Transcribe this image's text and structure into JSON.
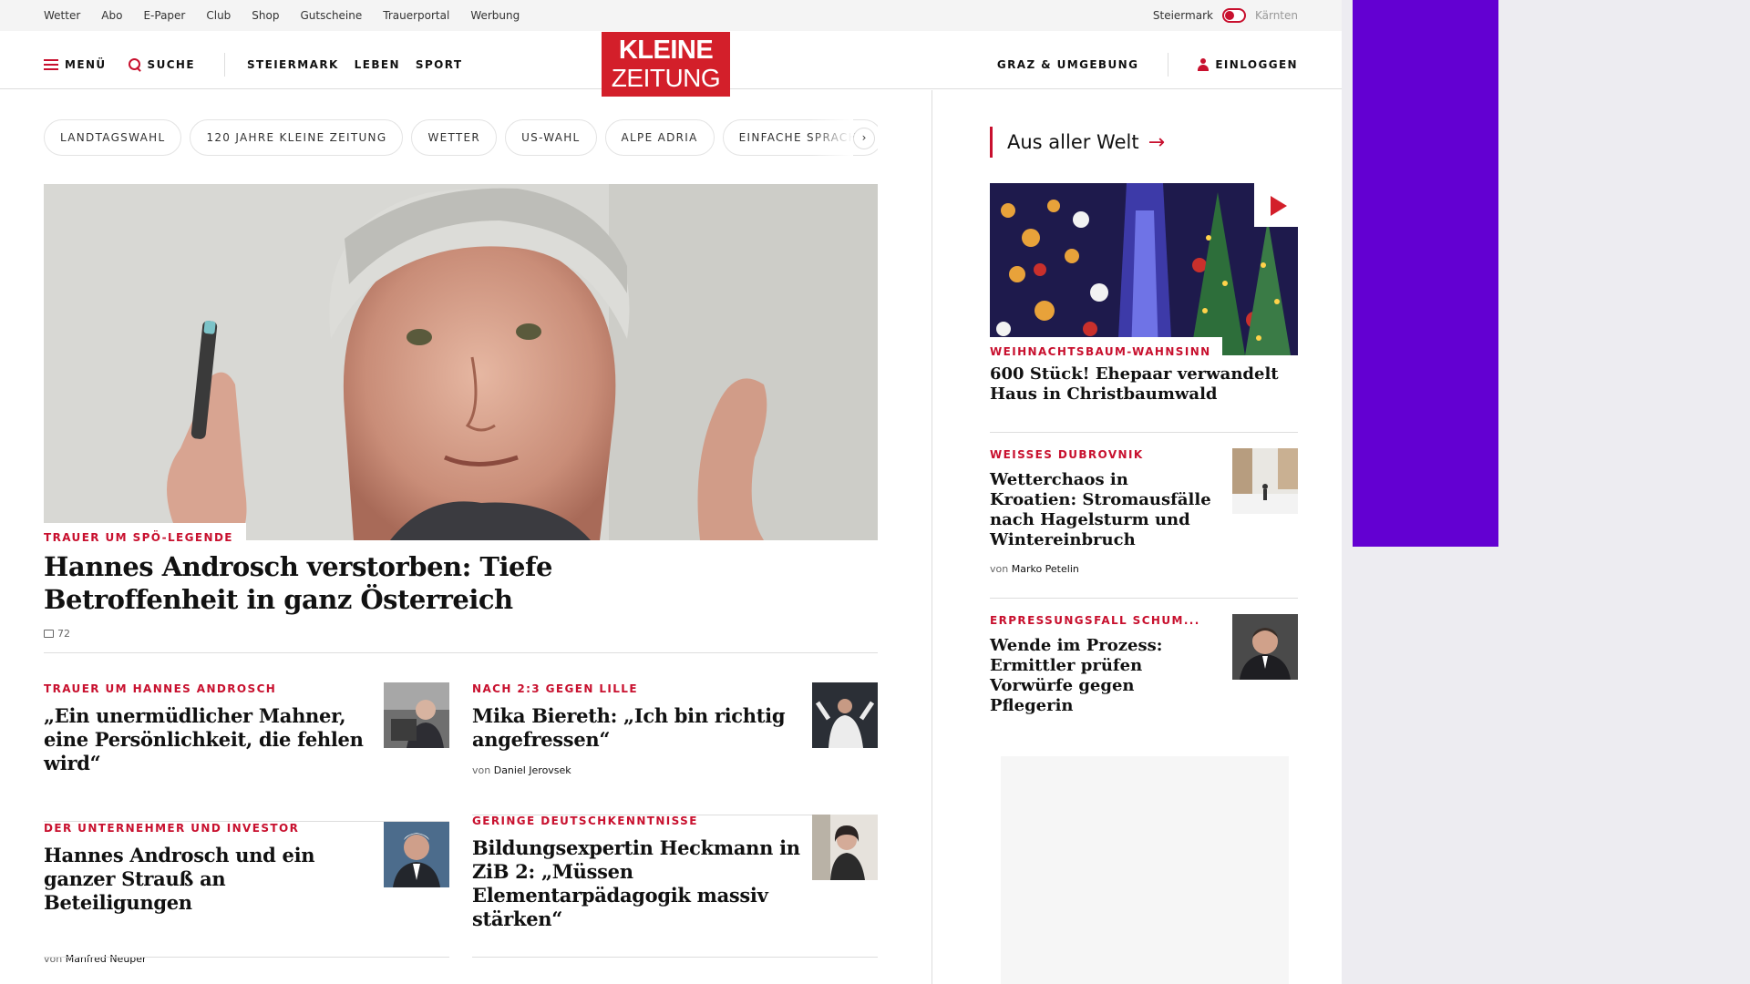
{
  "utility_bar": {
    "links": [
      "Wetter",
      "Abo",
      "E-Paper",
      "Club",
      "Shop",
      "Gutscheine",
      "Trauerportal",
      "Werbung"
    ],
    "region_active": "Steiermark",
    "region_inactive": "Kärnten"
  },
  "header": {
    "menu_label": "MENÜ",
    "search_label": "SUCHE",
    "nav_left": [
      "STEIERMARK",
      "LEBEN",
      "SPORT"
    ],
    "logo_line1": "KLEINE",
    "logo_line2": "ZEITUNG",
    "nav_right": "GRAZ & UMGEBUNG",
    "login_label": "EINLOGGEN"
  },
  "topics": [
    "LANDTAGSWAHL",
    "120 JAHRE KLEINE ZEITUNG",
    "WETTER",
    "US-WAHL",
    "ALPE ADRIA",
    "EINFACHE SPRACHE"
  ],
  "hero": {
    "kicker": "TRAUER UM SPÖ-LEGENDE",
    "title": "Hannes Androsch verstorben: Tiefe Betroffenheit in ganz Österreich",
    "comments": "72"
  },
  "cards": [
    {
      "kicker": "TRAUER UM HANNES ANDROSCH",
      "title": "„Ein unermüdlicher Mahner, eine Persönlichkeit, die fehlen wird“"
    },
    {
      "kicker": "NACH 2:3 GEGEN LILLE",
      "title": "Mika Biereth: „Ich bin richtig angefressen“",
      "author_prefix": "von",
      "author": "Daniel Jerovsek"
    },
    {
      "kicker": "DER UNTERNEHMER UND INVESTOR",
      "title": "Hannes Androsch und ein ganzer Strauß an Beteiligungen",
      "author_prefix": "von",
      "author": "Manfred Neuper"
    },
    {
      "kicker": "GERINGE DEUTSCHKENNTNISSE",
      "title": "Bildungsexpertin Heckmann in ZiB 2: „Müssen Elementarpädagogik massiv stärken“"
    }
  ],
  "sidebar": {
    "section_title": "Aus aller Welt",
    "feature": {
      "kicker": "WEIHNACHTSBAUM-WAHNSINN",
      "title": "600 Stück! Ehepaar verwandelt Haus in Christbaumwald"
    },
    "items": [
      {
        "kicker": "WEISSES DUBROVNIK",
        "title": "Wetterchaos in Kroatien: Stromausfälle nach Hagelsturm und Wintereinbruch",
        "author_prefix": "von",
        "author": "Marko Petelin"
      },
      {
        "kicker": "ERPRESSUNGSFALL SCHUM...",
        "title": "Wende im Prozess: Ermittler prüfen Vorwürfe gegen Pflegerin"
      }
    ]
  },
  "colors": {
    "brand_red": "#d31f2a",
    "kicker_red": "#c8102e",
    "ad_purple": "#6300d2"
  },
  "icons": [
    "menu-icon",
    "search-icon",
    "user-icon",
    "comment-icon",
    "arrow-right-icon",
    "play-icon",
    "chevron-right-icon"
  ]
}
